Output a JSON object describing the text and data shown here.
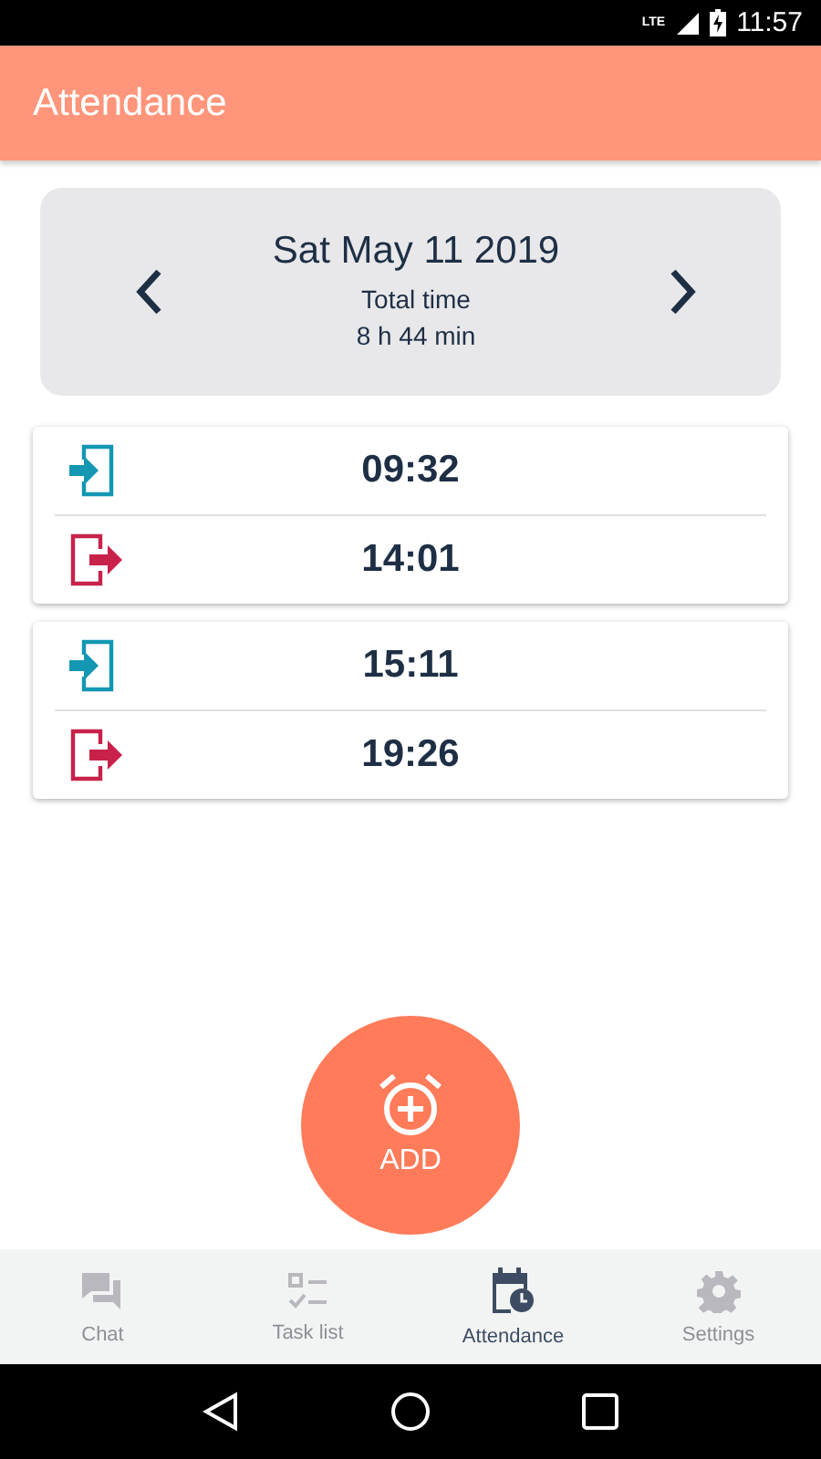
{
  "status_bar": {
    "network": "LTE",
    "time": "11:57"
  },
  "app_bar": {
    "title": "Attendance"
  },
  "day": {
    "date": "Sat May 11 2019",
    "total_label": "Total time",
    "total": "8 h 44 min"
  },
  "sessions": [
    {
      "entries": [
        {
          "kind": "in",
          "time": "09:32"
        },
        {
          "kind": "out",
          "time": "14:01"
        }
      ]
    },
    {
      "entries": [
        {
          "kind": "in",
          "time": "15:11"
        },
        {
          "kind": "out",
          "time": "19:26"
        }
      ]
    }
  ],
  "add_button": {
    "label": "ADD"
  },
  "bottom_nav": [
    {
      "kind": "chat",
      "label": "Chat",
      "selected": false
    },
    {
      "kind": "tasks",
      "label": "Task list",
      "selected": false
    },
    {
      "kind": "attendance",
      "label": "Attendance",
      "selected": true
    },
    {
      "kind": "settings",
      "label": "Settings",
      "selected": false
    }
  ]
}
